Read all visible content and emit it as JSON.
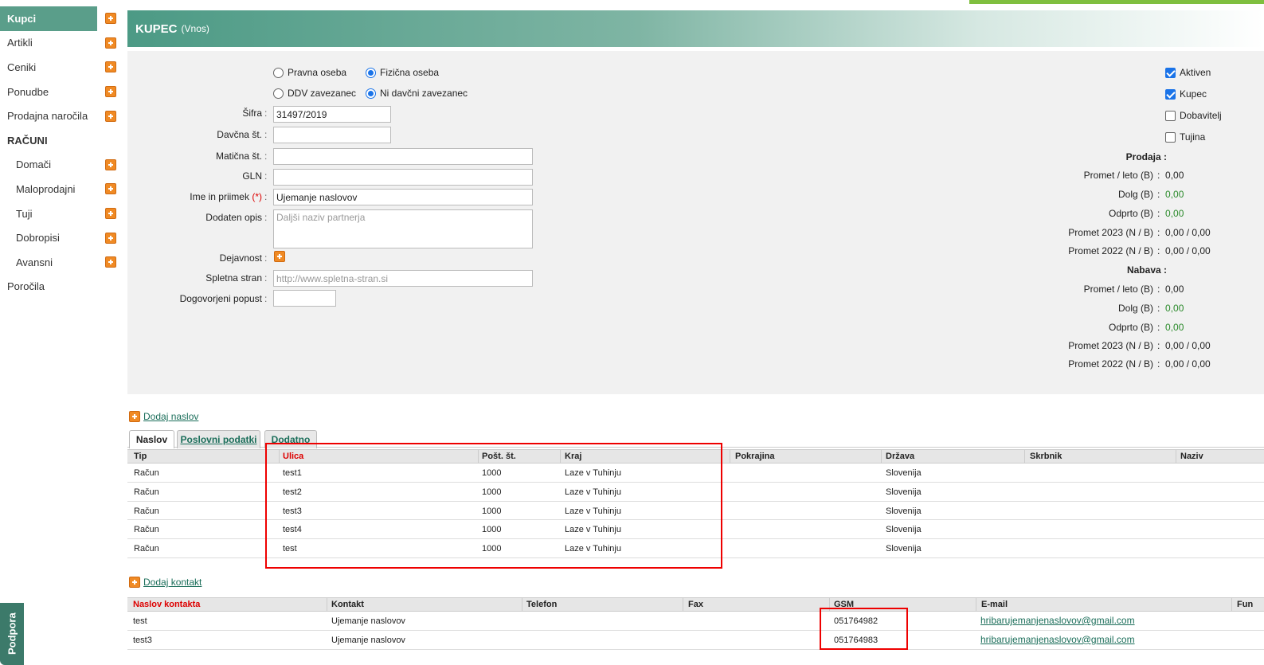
{
  "sidebar": {
    "items": [
      {
        "label": "Kupci",
        "active": true
      },
      {
        "label": "Artikli"
      },
      {
        "label": "Ceniki"
      },
      {
        "label": "Ponudbe"
      },
      {
        "label": "Prodajna naročila"
      }
    ],
    "section": "RAČUNI",
    "sub_items": [
      {
        "label": "Domači"
      },
      {
        "label": "Maloprodajni"
      },
      {
        "label": "Tuji"
      },
      {
        "label": "Dobropisi"
      },
      {
        "label": "Avansni"
      }
    ],
    "last_item": "Poročila",
    "support_tab": "Podpora"
  },
  "header": {
    "title": "KUPEC",
    "subtitle": "(Vnos)"
  },
  "form": {
    "radio_legal": "Pravna oseba",
    "radio_natural": "Fizična oseba",
    "radio_vat": "DDV zavezanec",
    "radio_novat": "Ni davčni zavezanec",
    "sifra_label": "Šifra",
    "sifra_value": "31497/2019",
    "davcna_label": "Davčna št.",
    "davcna_value": "",
    "maticna_label": "Matična št.",
    "maticna_value": "",
    "gln_label": "GLN",
    "gln_value": "",
    "ime_label": "Ime in priimek",
    "ime_req": "(*)",
    "ime_value": "Ujemanje naslovov",
    "opis_label": "Dodaten opis",
    "opis_placeholder": "Daljši naziv partnerja",
    "dejavnost_label": "Dejavnost",
    "spletna_label": "Spletna stran",
    "spletna_placeholder": "http://www.spletna-stran.si",
    "popust_label": "Dogovorjeni popust",
    "popust_value": "",
    "colon": ":"
  },
  "checks": {
    "aktiven": "Aktiven",
    "kupec": "Kupec",
    "dobavitelj": "Dobavitelj",
    "tujina": "Tujina"
  },
  "stats": {
    "prodaja_head": "Prodaja :",
    "nabava_head": "Nabava :",
    "prodaja": [
      {
        "label": "Promet / leto (B)",
        "value": "0,00",
        "green": false
      },
      {
        "label": "Dolg (B)",
        "value": "0,00",
        "green": true
      },
      {
        "label": "Odprto (B)",
        "value": "0,00",
        "green": true
      },
      {
        "label": "Promet 2023 (N / B)",
        "value": "0,00 / 0,00",
        "green": false
      },
      {
        "label": "Promet 2022 (N / B)",
        "value": "0,00 / 0,00",
        "green": false
      }
    ],
    "nabava": [
      {
        "label": "Promet / leto (B)",
        "value": "0,00",
        "green": false
      },
      {
        "label": "Dolg (B)",
        "value": "0,00",
        "green": true
      },
      {
        "label": "Odprto (B)",
        "value": "0,00",
        "green": true
      },
      {
        "label": "Promet 2023 (N / B)",
        "value": "0,00 / 0,00",
        "green": false
      },
      {
        "label": "Promet 2022 (N / B)",
        "value": "0,00 / 0,00",
        "green": false
      }
    ]
  },
  "add_address": "Dodaj naslov",
  "tabs": [
    "Naslov",
    "Poslovni podatki",
    "Dodatno"
  ],
  "address_table": {
    "headers": [
      "Tip",
      "Ulica",
      "Pošt. št.",
      "Kraj",
      "Pokrajina",
      "Država",
      "Skrbnik",
      "Naziv"
    ],
    "rows": [
      [
        "Račun",
        "test1",
        "1000",
        "Laze v Tuhinju",
        "",
        "Slovenija",
        "",
        ""
      ],
      [
        "Račun",
        "test2",
        "1000",
        "Laze v Tuhinju",
        "",
        "Slovenija",
        "",
        ""
      ],
      [
        "Račun",
        "test3",
        "1000",
        "Laze v Tuhinju",
        "",
        "Slovenija",
        "",
        ""
      ],
      [
        "Račun",
        "test4",
        "1000",
        "Laze v Tuhinju",
        "",
        "Slovenija",
        "",
        ""
      ],
      [
        "Račun",
        "test",
        "1000",
        "Laze v Tuhinju",
        "",
        "Slovenija",
        "",
        ""
      ]
    ]
  },
  "add_contact": "Dodaj kontakt",
  "contact_table": {
    "headers": [
      "Naslov kontakta",
      "Kontakt",
      "Telefon",
      "Fax",
      "GSM",
      "E-mail",
      "Fun"
    ],
    "rows": [
      [
        "test",
        "Ujemanje naslovov",
        "",
        "",
        "051764982",
        "hribarujemanjenaslovov@gmail.com",
        ""
      ],
      [
        "test3",
        "Ujemanje naslovov",
        "",
        "",
        "051764983",
        "hribarujemanjenaslovov@gmail.com",
        ""
      ]
    ]
  }
}
